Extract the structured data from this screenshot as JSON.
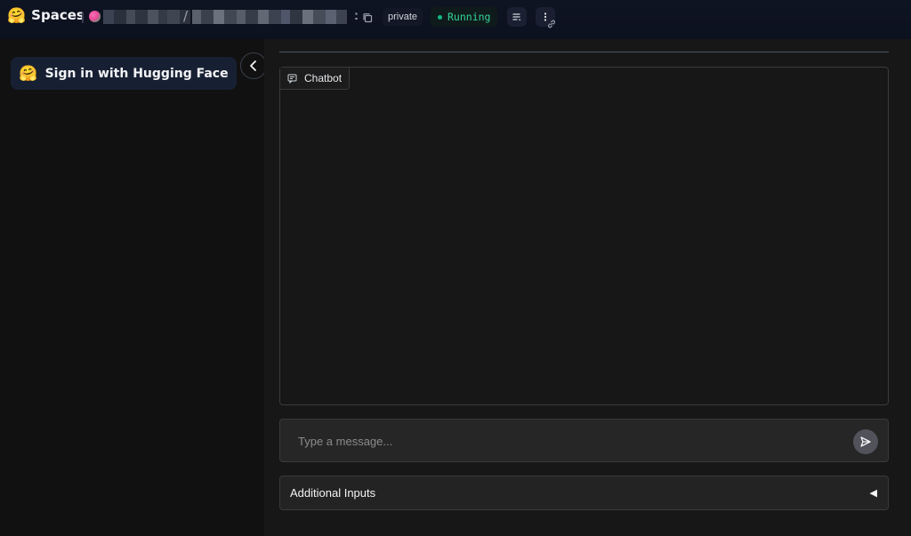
{
  "topbar": {
    "brand_emoji": "🤗",
    "brand_label": "Spaces",
    "separator": "/",
    "colon": ":",
    "visibility_badge": "private",
    "status_badge": "Running",
    "status_color": "#34d399",
    "icons": [
      "copy-icon",
      "logs-icon",
      "more-vertical-icon",
      "link-icon"
    ]
  },
  "sidebar": {
    "signin_emoji": "🤗",
    "signin_label": "Sign in with Hugging Face",
    "collapse_icon": "chevron-left-icon"
  },
  "main": {
    "chatbot_label": "Chatbot",
    "chatbot_icon": "chat-bubble-icon",
    "message_placeholder": "Type a message...",
    "send_icon": "send-icon",
    "accordion_title": "Additional Inputs",
    "accordion_arrow": "◀"
  }
}
